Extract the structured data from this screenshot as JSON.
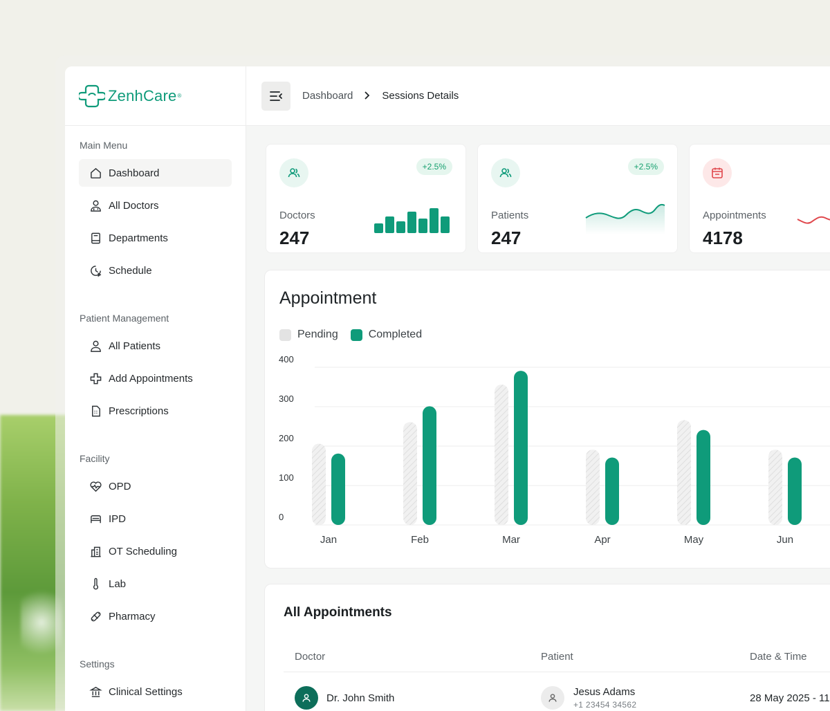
{
  "brand": {
    "name": "ZenhCare",
    "reg": "®",
    "color": "#0f9b7a"
  },
  "sidebar": {
    "sections": [
      {
        "title": "Main Menu",
        "items": [
          {
            "label": "Dashboard",
            "icon": "home-icon",
            "active": true
          },
          {
            "label": "All Doctors",
            "icon": "doctor-icon"
          },
          {
            "label": "Departments",
            "icon": "book-icon"
          },
          {
            "label": "Schedule",
            "icon": "clock-icon"
          }
        ]
      },
      {
        "title": "Patient Management",
        "items": [
          {
            "label": "All Patients",
            "icon": "user-icon"
          },
          {
            "label": "Add Appointments",
            "icon": "medical-cross-icon"
          },
          {
            "label": "Prescriptions",
            "icon": "prescription-icon"
          }
        ]
      },
      {
        "title": "Facility",
        "items": [
          {
            "label": "OPD",
            "icon": "heartbeat-icon"
          },
          {
            "label": "IPD",
            "icon": "bed-icon"
          },
          {
            "label": "OT Scheduling",
            "icon": "hospital-icon"
          },
          {
            "label": "Lab",
            "icon": "thermometer-icon"
          },
          {
            "label": "Pharmacy",
            "icon": "pill-icon"
          }
        ]
      },
      {
        "title": "Settings",
        "items": [
          {
            "label": "Clinical Settings",
            "icon": "institution-icon"
          }
        ]
      }
    ]
  },
  "topbar": {
    "breadcrumb": [
      "Dashboard",
      "Sessions Details"
    ],
    "separator": ">"
  },
  "stats": [
    {
      "label": "Doctors",
      "value": "247",
      "badge": "+2.5%",
      "icon": "users-icon",
      "spark": [
        14,
        24,
        17,
        31,
        21,
        36,
        24
      ]
    },
    {
      "label": "Patients",
      "value": "247",
      "badge": "+2.5%",
      "icon": "users-icon"
    },
    {
      "label": "Appointments",
      "value": "4178",
      "icon": "calendar-icon"
    }
  ],
  "appointment_chart": {
    "title": "Appointment",
    "legend": [
      {
        "name": "Pending",
        "color": "#e3e3e3"
      },
      {
        "name": "Completed",
        "color": "#0f9b7a"
      }
    ]
  },
  "chart_data": {
    "type": "bar",
    "categories": [
      "Jan",
      "Feb",
      "Mar",
      "Apr",
      "May",
      "Jun"
    ],
    "series": [
      {
        "name": "Pending",
        "values": [
          185,
          240,
          335,
          170,
          245,
          170
        ]
      },
      {
        "name": "Completed",
        "values": [
          160,
          280,
          370,
          150,
          220,
          150
        ]
      }
    ],
    "yticks": [
      "400",
      "300",
      "200",
      "100",
      "0"
    ],
    "ylim": [
      0,
      400
    ],
    "grid": true,
    "legend_position": "top-left"
  },
  "appointments_table": {
    "title": "All Appointments",
    "columns": [
      "Doctor",
      "Patient",
      "Date & Time"
    ],
    "rows": [
      {
        "doctor": "Dr. John Smith",
        "patient": "Jesus Adams",
        "phone": "+1 23454 34562",
        "datetime": "28 May 2025 - 11"
      }
    ]
  }
}
